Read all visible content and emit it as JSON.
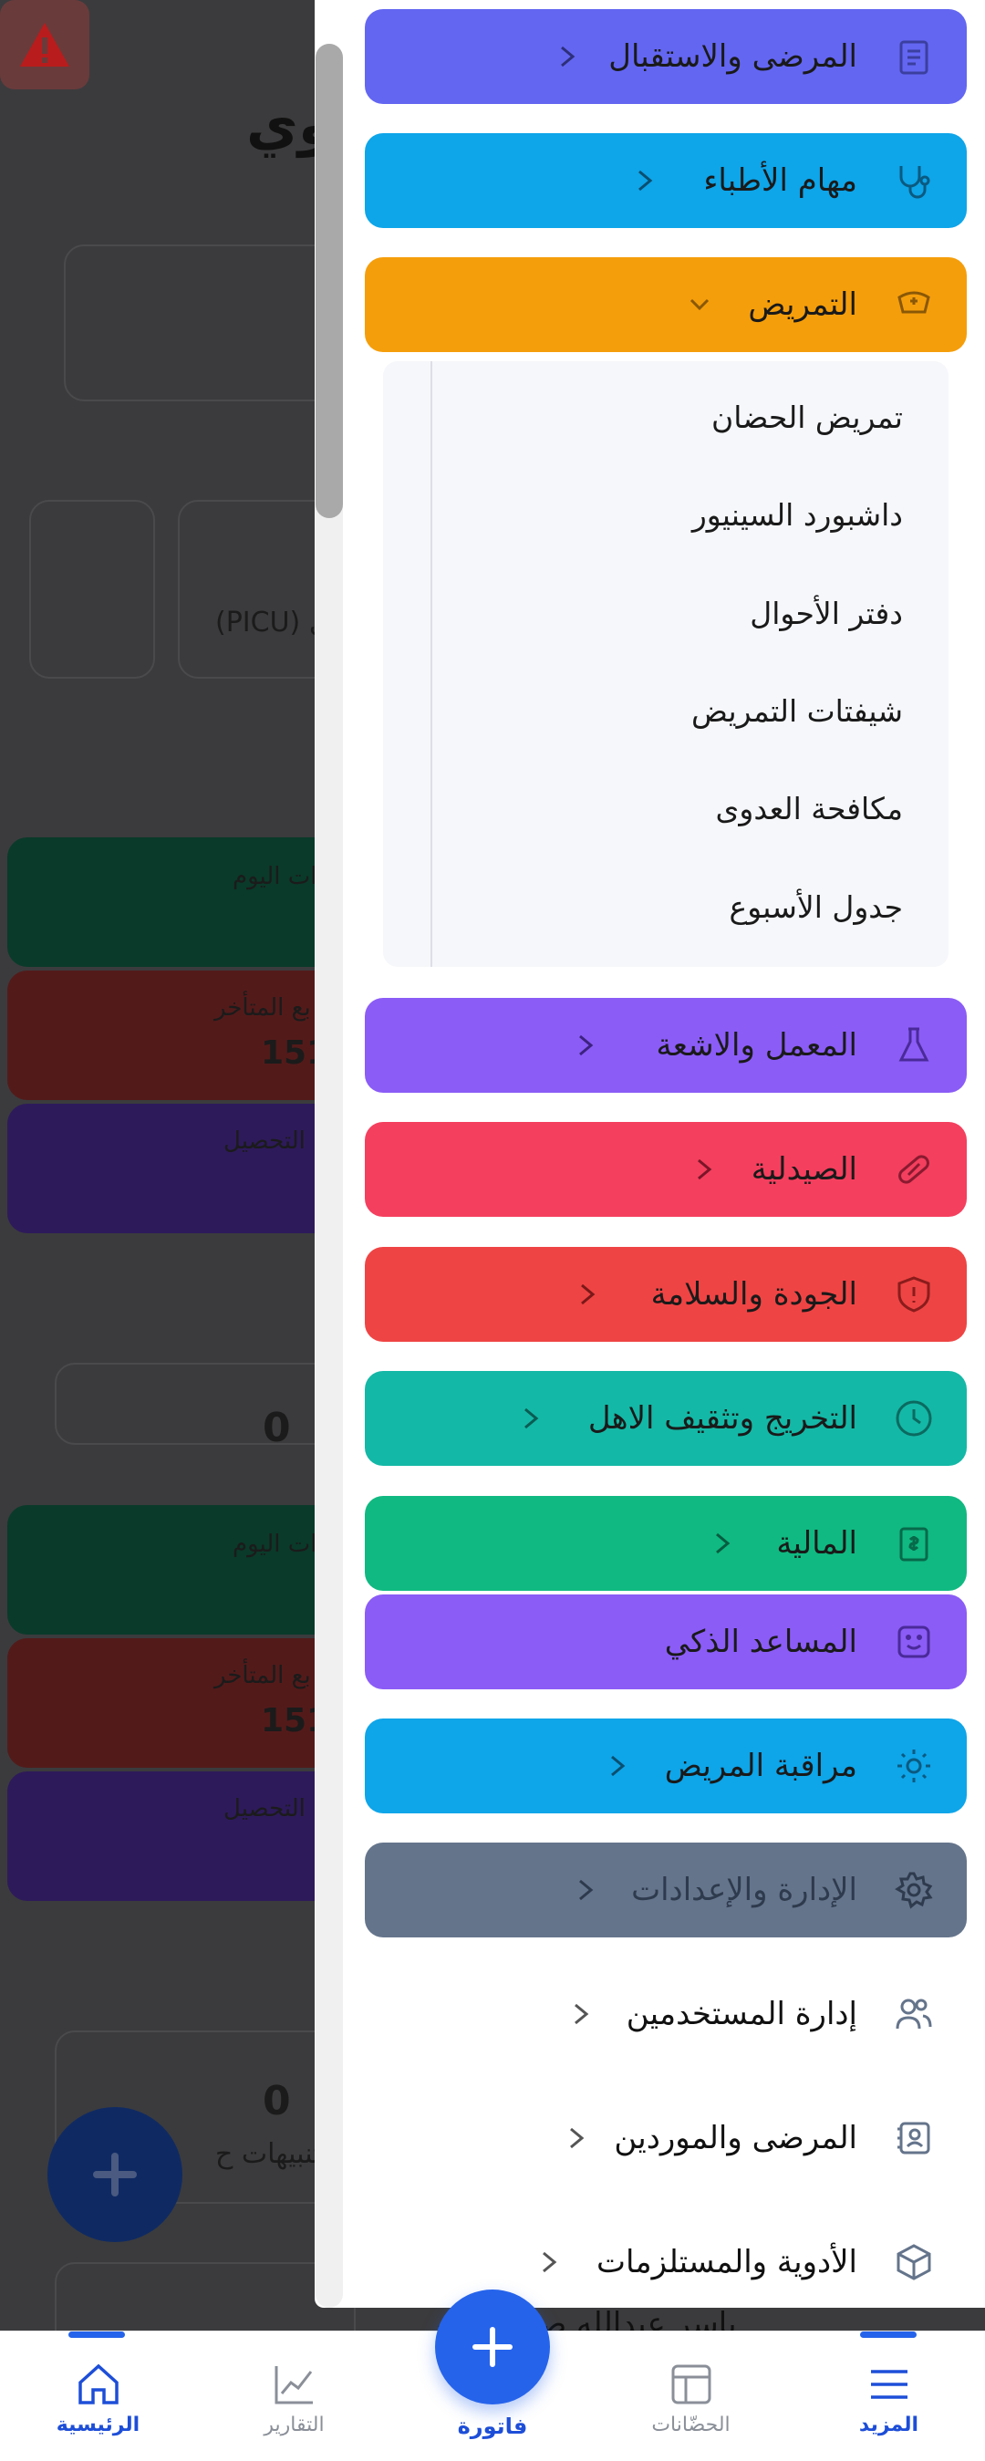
{
  "background": {
    "title_fragment": "وي",
    "stat_labels": [
      "ات اليوم",
      "بع المتأخر",
      "ة التحصيل",
      "ات اليوم",
      "بع المتأخر",
      "ة التحصيل"
    ],
    "stat_values": [
      "151",
      "151"
    ],
    "picu_label": "(PICU) ل",
    "zero_value": "0",
    "zero_value_2": "0",
    "alerts_label": "تنبيهات ح",
    "patient_name_fragment": "ياسر عبدالله صالح السر"
  },
  "drawer": {
    "items": [
      {
        "label": "المرضى والاستقبال",
        "icon": "clipboard-list-icon",
        "color": "#6366f1",
        "chevron": "right"
      },
      {
        "label": "مهام الأطباء",
        "icon": "stethoscope-icon",
        "color": "#0ea5e9",
        "chevron": "right"
      },
      {
        "label": "التمريض",
        "icon": "nurse-cap-icon",
        "color": "#f59e0b",
        "chevron": "down"
      }
    ],
    "nursing_submenu": [
      "تمريض الحضان",
      "داشبورد السينيور",
      "دفتر الأحوال",
      "شيفتات التمريض",
      "مكافحة العدوى",
      "جدول الأسبوع"
    ],
    "items_after": [
      {
        "label": "المعمل والاشعة",
        "icon": "flask-icon",
        "color": "#8b5cf6",
        "chevron": "right"
      },
      {
        "label": "الصيدلية",
        "icon": "pill-icon",
        "color": "#f43f5e",
        "chevron": "right"
      },
      {
        "label": "الجودة والسلامة",
        "icon": "shield-icon",
        "color": "#ef4444",
        "chevron": "right"
      },
      {
        "label": "التخريج وتثقيف الاهل",
        "icon": "clock-icon",
        "color": "#14b8a6",
        "chevron": "right"
      },
      {
        "label": "المالية",
        "icon": "receipt-icon",
        "color": "#10b981",
        "chevron": "right"
      },
      {
        "label": "المساعد الذكي",
        "icon": "smile-icon",
        "color": "#8b5cf6",
        "chevron": "none"
      },
      {
        "label": "مراقبة المريض",
        "icon": "sun-icon",
        "color": "#0ea5e9",
        "chevron": "right"
      },
      {
        "label": "الإدارة والإعدادات",
        "icon": "gear-icon",
        "color": "#64748b",
        "chevron": "right"
      }
    ],
    "admin_items": [
      {
        "label": "إدارة المستخدمين",
        "icon": "users-icon"
      },
      {
        "label": "المرضى والموردين",
        "icon": "contact-book-icon"
      },
      {
        "label": "الأدوية والمستلزمات",
        "icon": "box-icon"
      }
    ]
  },
  "bottom_nav": {
    "tabs": [
      {
        "label": "الرئيسية",
        "icon": "home-icon",
        "active": true
      },
      {
        "label": "التقارير",
        "icon": "chart-line-icon",
        "active": false
      },
      {
        "label": "فاتورة",
        "icon": "plus-icon",
        "active": false
      },
      {
        "label": "الحضّانات",
        "icon": "layout-icon",
        "active": false
      },
      {
        "label": "المزيد",
        "icon": "menu-icon",
        "active": true
      }
    ]
  },
  "colors": {
    "accent": "#2563eb",
    "overlay": "#3b3b3d"
  }
}
